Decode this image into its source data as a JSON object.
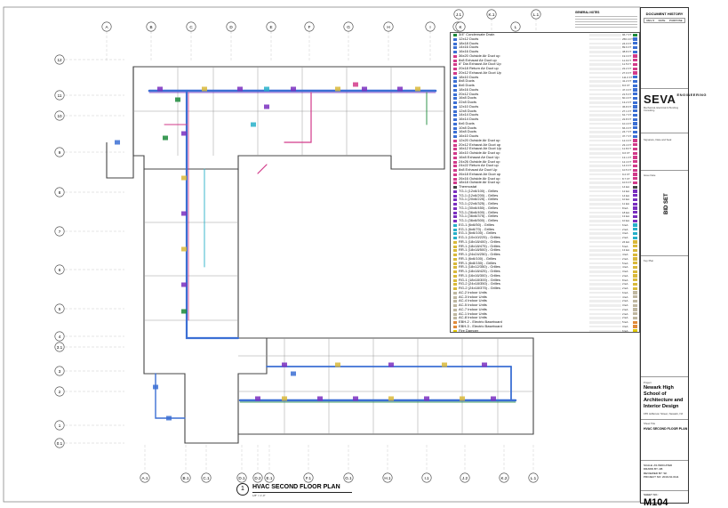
{
  "sheet": {
    "general_notes_title": "GENERAL NOTES",
    "plan_title_number": "1",
    "plan_title": "HVAC SECOND FLOOR PLAN",
    "plan_scale": "1/8\" = 1'-0\""
  },
  "grid": {
    "top_labels": [
      "A",
      "B",
      "C",
      "D",
      "E",
      "F",
      "G",
      "H",
      "I",
      "J",
      "J.1",
      "K",
      "K.1",
      "L",
      "L.1"
    ],
    "bottom_labels": [
      "A.1",
      "B.1",
      "C.1",
      "D.1",
      "D.2",
      "E.1",
      "F.1",
      "G.1",
      "H.1",
      "I.1",
      "J.2",
      "K.2",
      "L.1"
    ],
    "row_labels": [
      "12",
      "11",
      "10",
      "9",
      "8",
      "7",
      "6",
      "5",
      "4",
      "3.1",
      "3",
      "2",
      "1",
      "0.1"
    ]
  },
  "legend": {
    "items": [
      {
        "label": "3/4\" Condensate Drain",
        "qty": "96.7 FT",
        "color": "#1b8a3a"
      },
      {
        "label": "12x12 Ducts",
        "qty": "256.4 FT",
        "color": "#3b6fd4"
      },
      {
        "label": "18x18 Ducts",
        "qty": "24.0 FT",
        "color": "#3b6fd4"
      },
      {
        "label": "14x16 Ducts",
        "qty": "89.6 FT",
        "color": "#3b6fd4"
      },
      {
        "label": "16x16 Ducts",
        "qty": "38.8 FT",
        "color": "#3b6fd4"
      },
      {
        "label": "36x20 Outside Air Duct up",
        "qty": "19.3 FT",
        "color": "#d23a8a"
      },
      {
        "label": "8x8 Exhaust Air Duct up",
        "qty": "11.9 FT",
        "color": "#d23a8a"
      },
      {
        "label": "8\" Dia Exhaust Air Duct Up",
        "qty": "11.5 FT",
        "color": "#d23a8a"
      },
      {
        "label": "20x18 Return Air Duct up",
        "qty": "22.2 FT",
        "color": "#d23a8a"
      },
      {
        "label": "20x12 Exhaust Air Duct Up",
        "qty": "27.0 FT",
        "color": "#d23a8a"
      },
      {
        "label": "18x10 Ducts",
        "qty": "111.0 FT",
        "color": "#3b6fd4"
      },
      {
        "label": "8x8 Ducts",
        "qty": "41.2 FT",
        "color": "#3b6fd4"
      },
      {
        "label": "8x6 Ducts",
        "qty": "8.6 FT",
        "color": "#3b6fd4"
      },
      {
        "label": "18x16 Ducts",
        "qty": "47.3 FT",
        "color": "#3b6fd4"
      },
      {
        "label": "20x12 Ducts",
        "qty": "21.5 FT",
        "color": "#3b6fd4"
      },
      {
        "label": "16x8 Ducts",
        "qty": "60.4 FT",
        "color": "#3b6fd4"
      },
      {
        "label": "22x8 Ducts",
        "qty": "13.2 FT",
        "color": "#3b6fd4"
      },
      {
        "label": "12x10 Ducts",
        "qty": "36.8 FT",
        "color": "#3b6fd4"
      },
      {
        "label": "12x8 Ducts",
        "qty": "27.1 FT",
        "color": "#3b6fd4"
      },
      {
        "label": "14x14 Ducts",
        "qty": "61.7 FT",
        "color": "#3b6fd4"
      },
      {
        "label": "16x14 Ducts",
        "qty": "22.8 FT",
        "color": "#3b6fd4"
      },
      {
        "label": "6x6 Ducts",
        "qty": "10.4 FT",
        "color": "#3b6fd4"
      },
      {
        "label": "10x8 Ducts",
        "qty": "66.3 FT",
        "color": "#3b6fd4"
      },
      {
        "label": "16x8 Ducts",
        "qty": "24.7 FT",
        "color": "#3b6fd4"
      },
      {
        "label": "16x10 Ducts",
        "qty": "37.7 FT",
        "color": "#3b6fd4"
      },
      {
        "label": "12x20 Outside Air Duct up",
        "qty": "12.3 FT",
        "color": "#d23a8a"
      },
      {
        "label": "20x12 Exhaust Air Duct up",
        "qty": "23.4 FT",
        "color": "#d23a8a"
      },
      {
        "label": "16x12 Exhaust Air Duct Up",
        "qty": "11.8 FT",
        "color": "#d23a8a"
      },
      {
        "label": "16x10 Outside Air Duct up",
        "qty": "9.6 FT",
        "color": "#d23a8a"
      },
      {
        "label": "16x8 Exhaust Air Duct Up",
        "qty": "13.1 FT",
        "color": "#d23a8a"
      },
      {
        "label": "24x26 Outside Air Duct up",
        "qty": "12.4 FT",
        "color": "#d23a8a"
      },
      {
        "label": "24x22 Return Air Duct up",
        "qty": "14.0 FT",
        "color": "#d23a8a"
      },
      {
        "label": "8x8 Exhaust Air Duct Up",
        "qty": "10.5 FT",
        "color": "#d23a8a"
      },
      {
        "label": "26x18 Exhaust Air Duct up",
        "qty": "9.2 FT",
        "color": "#d23a8a"
      },
      {
        "label": "26x16 Outside Air Duct up",
        "qty": "8.7 FT",
        "color": "#d23a8a"
      },
      {
        "label": "18x18 Outside Air Duct up",
        "qty": "10.6 FT",
        "color": "#d23a8a"
      },
      {
        "label": "Thermostat",
        "qty": "14 EA",
        "color": "#444444"
      },
      {
        "label": "TG-1 (12x6/100) - Grilles",
        "qty": "12 EA",
        "color": "#7a2fbf"
      },
      {
        "label": "TG-1 (12x6/200) - Grilles",
        "qty": "14 EA",
        "color": "#7a2fbf"
      },
      {
        "label": "TG-1 (20x6/225) - Grilles",
        "qty": "10 EA",
        "color": "#7a2fbf"
      },
      {
        "label": "TG-1 (22x6/325) - Grilles",
        "qty": "11 EA",
        "color": "#7a2fbf"
      },
      {
        "label": "TG-1 (30x6/450) - Grilles",
        "qty": "8 EA",
        "color": "#7a2fbf"
      },
      {
        "label": "TG-1 (36x6/400) - Grilles",
        "qty": "18 EA",
        "color": "#7a2fbf"
      },
      {
        "label": "TG-1 (36x6/375) - Grilles",
        "qty": "13 EA",
        "color": "#7a2fbf"
      },
      {
        "label": "TG-1 (36x6/500) - Grilles",
        "qty": "10 EA",
        "color": "#7a2fbf"
      },
      {
        "label": "EG-1 (6x6/50) - Grilles",
        "qty": "6 EA",
        "color": "#27b0c9"
      },
      {
        "label": "EG-1 (6x6/70) - Grilles",
        "qty": "2 EA",
        "color": "#27b0c9"
      },
      {
        "label": "EG-1 (6x6/100) - Grilles",
        "qty": "3 EA",
        "color": "#27b0c9"
      },
      {
        "label": "EG-1 (10x10/225) - Grilles",
        "qty": "2 EA",
        "color": "#27b0c9"
      },
      {
        "label": "RR-1 (18x18/400) - Grilles",
        "qty": "24 EA",
        "color": "#d9b93a"
      },
      {
        "label": "RR-1 (18x18/475) - Grilles",
        "qty": "5 EA",
        "color": "#d9b93a"
      },
      {
        "label": "RR-1 (18x18/500) - Grilles",
        "qty": "13 EA",
        "color": "#d9b93a"
      },
      {
        "label": "RR-1 (24x24/250) - Grilles",
        "qty": "4 EA",
        "color": "#d9b93a"
      },
      {
        "label": "RR-1 (6x6/100) - Grilles",
        "qty": "2 EA",
        "color": "#d9b93a"
      },
      {
        "label": "RR-1 (8x8/150) - Grilles",
        "qty": "5 EA",
        "color": "#d9b93a"
      },
      {
        "label": "RR-1 (18x12/350) - Grilles",
        "qty": "4 EA",
        "color": "#d9b93a"
      },
      {
        "label": "RR-1 (18x18/425) - Grilles",
        "qty": "3 EA",
        "color": "#d9b93a"
      },
      {
        "label": "RR-1 (16x16/300) - Grilles",
        "qty": "2 EA",
        "color": "#d9b93a"
      },
      {
        "label": "RG-1 (18x18/300) - Grilles",
        "qty": "8 EA",
        "color": "#d9b93a"
      },
      {
        "label": "RG-2 (24x18/350) - Grilles",
        "qty": "2 EA",
        "color": "#d9b93a"
      },
      {
        "label": "RG-2 (24x18/375) - Grilles",
        "qty": "2 EA",
        "color": "#d9b93a"
      },
      {
        "label": "AC-2 Indoor Units",
        "qty": "6 EA",
        "color": "#bfb7a0"
      },
      {
        "label": "AC-3 Indoor Units",
        "qty": "4 EA",
        "color": "#bfb7a0"
      },
      {
        "label": "AC-4 Indoor Units",
        "qty": "2 EA",
        "color": "#bfb7a0"
      },
      {
        "label": "AC-5 Indoor Units",
        "qty": "3 EA",
        "color": "#bfb7a0"
      },
      {
        "label": "AC-7 Indoor Units",
        "qty": "2 EA",
        "color": "#bfb7a0"
      },
      {
        "label": "AC-1 Indoor Units",
        "qty": "2 EA",
        "color": "#bfb7a0"
      },
      {
        "label": "AC-8 Indoor Units",
        "qty": "2 EA",
        "color": "#bfb7a0"
      },
      {
        "label": "EBH-2 - Electric Baseboard",
        "qty": "5 EA",
        "color": "#e08a3a"
      },
      {
        "label": "EBH-3 - Electric Baseboard",
        "qty": "3 EA",
        "color": "#e08a3a"
      },
      {
        "label": "Fire Damper",
        "qty": "6 EA",
        "color": "#e0c800"
      }
    ]
  },
  "titleblock": {
    "document_history": "DOCUMENT HISTORY",
    "hist_cols": [
      "REV #",
      "DATE",
      "PURPOSE"
    ],
    "logo_main": "SEVA",
    "logo_side": "ENGINEERING",
    "logo_sub": "Mechanical, Electrical & Plumbing Consulting",
    "stamp_label": "Signature, Date and Seal",
    "issue_label": "Issue Date",
    "bid_set": "BID SET",
    "key_plan_label": "Key Plan",
    "project_label": "Project",
    "project_name": "Newark High School of Architecture and Interior Design",
    "project_address": "155 Jefferson Street, Newark, NJ",
    "sheet_title_label": "Sheet Title",
    "sheet_title": "HVAC SECOND FLOOR PLAN",
    "scale_line": "SCALE: AS INDICATED",
    "drawn_line": "DRAWN BY: AB",
    "reviewed_line": "REVIEWED BY: SK",
    "project_no_line": "PROJECT NO: 2019-NJ-0111",
    "sheet_no_label": "SHEET NO.:",
    "sheet_no": "M104"
  }
}
